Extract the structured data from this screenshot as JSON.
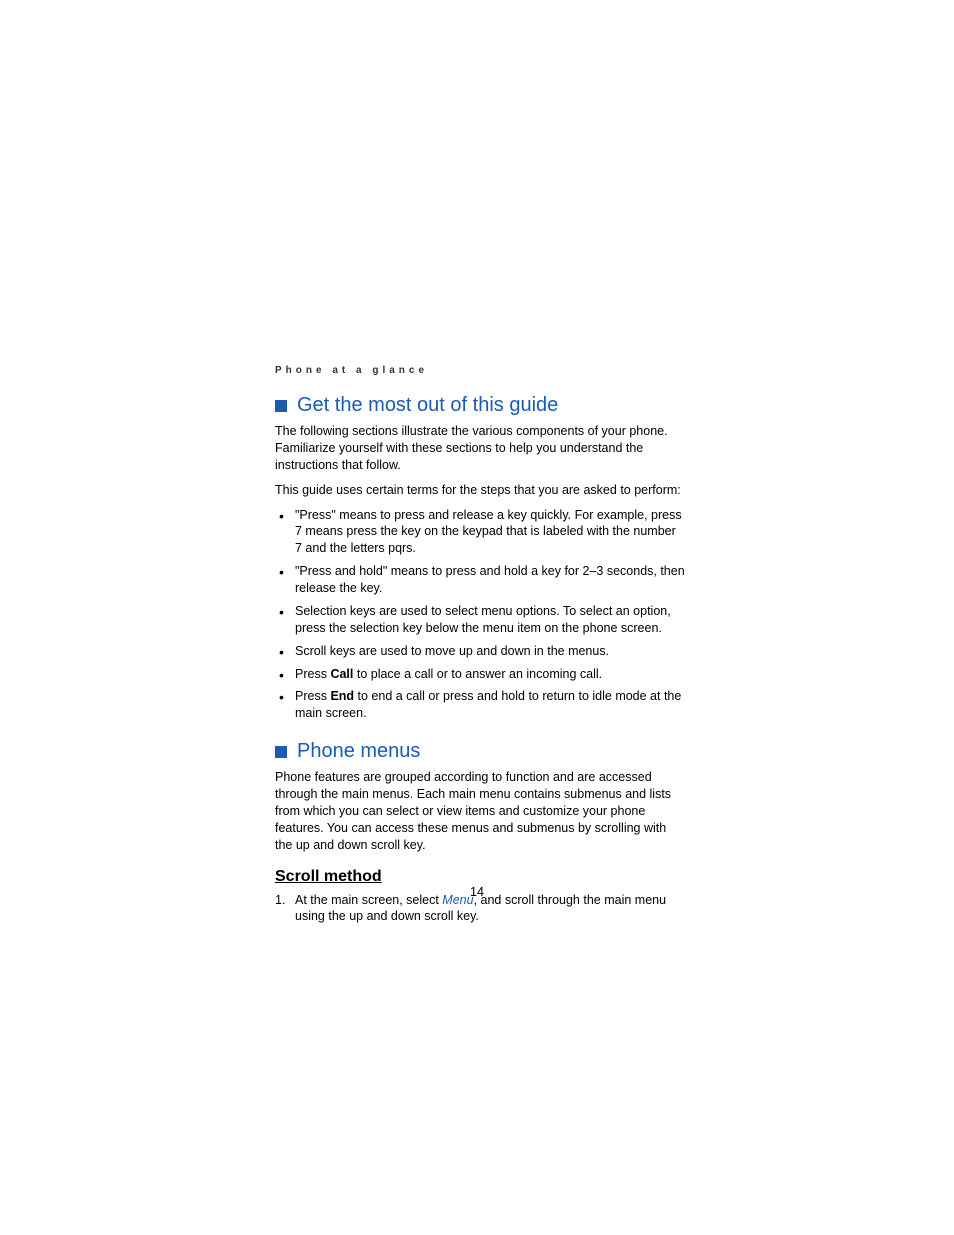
{
  "running_header": "Phone at a glance",
  "section1": {
    "heading": "Get the most out of this guide",
    "intro": "The following sections illustrate the various components of your phone. Familiarize yourself with these sections to help you understand the instructions that follow.",
    "subtext": "This guide uses certain terms for the steps that you are asked to perform:",
    "bullets": [
      {
        "text": "\"Press\" means to press and release a key quickly. For example, press 7 means press the key on the keypad that is labeled with the number 7 and the letters pqrs."
      },
      {
        "text": "\"Press and hold\" means to press and hold a key for 2–3 seconds, then release the key."
      },
      {
        "text": "Selection keys are used to select menu options. To select an option, press the selection key below the menu item on the phone screen."
      },
      {
        "text": "Scroll keys are used to move up and down in the menus."
      },
      {
        "prefix": "Press ",
        "bold": "Call",
        "suffix": " to place a call or to answer an incoming call."
      },
      {
        "prefix": "Press ",
        "bold": "End",
        "suffix": " to end a call or press and hold to return to idle mode at the main screen."
      }
    ]
  },
  "section2": {
    "heading": "Phone menus",
    "intro": "Phone features are grouped according to function and are accessed through the main menus. Each main menu contains submenus and lists from which you can select or view items and customize your phone features. You can access these menus and submenus by scrolling with the up and down scroll key.",
    "subheading": "Scroll method",
    "steps": [
      {
        "prefix": "At the main screen, select ",
        "link": "Menu",
        "suffix": ", and scroll through the main menu using the up and down scroll key."
      }
    ]
  },
  "page_number": "14"
}
